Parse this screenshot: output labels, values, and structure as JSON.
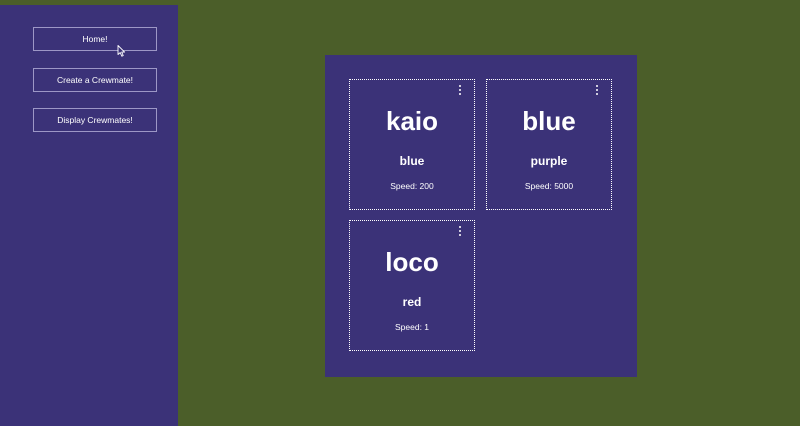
{
  "sidebar": {
    "items": [
      {
        "label": "Home!"
      },
      {
        "label": "Create a Crewmate!"
      },
      {
        "label": "Display Crewmates!"
      }
    ]
  },
  "gallery": {
    "cards": [
      {
        "name": "kaio",
        "color": "blue",
        "speed": "Speed: 200"
      },
      {
        "name": "blue",
        "color": "purple",
        "speed": "Speed: 5000"
      },
      {
        "name": "loco",
        "color": "red",
        "speed": "Speed: 1"
      }
    ]
  },
  "colors": {
    "page_background": "#4b5e29",
    "panel_background": "#3b3278",
    "text": "#ffffff"
  },
  "icons": {
    "card_menu": "kebab-menu-icon",
    "pointer": "mouse-cursor-icon"
  }
}
